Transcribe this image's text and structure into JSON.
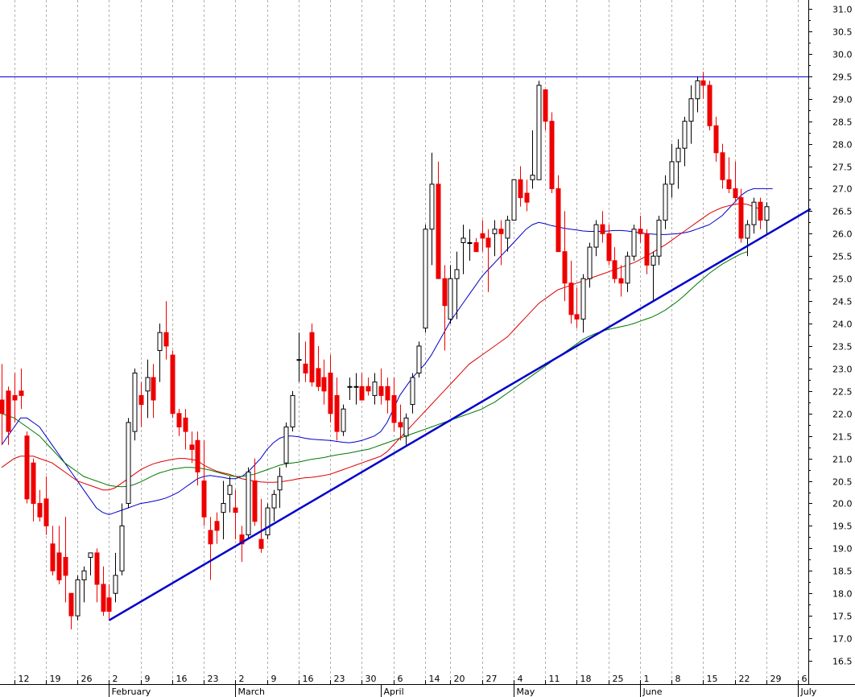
{
  "chart_data": {
    "type": "candlestick",
    "title": "",
    "xlabel": "",
    "ylabel": "",
    "ylim": [
      16.5,
      31.0
    ],
    "y_ticks": [
      "16.5",
      "17.0",
      "17.5",
      "18.0",
      "18.5",
      "19.0",
      "19.5",
      "20.0",
      "20.5",
      "21.0",
      "21.5",
      "22.0",
      "22.5",
      "23.0",
      "23.5",
      "24.0",
      "24.5",
      "25.0",
      "25.5",
      "26.0",
      "26.5",
      "27.0",
      "27.5",
      "28.0",
      "28.5",
      "29.0",
      "29.5",
      "30.0",
      "30.5",
      "31.0"
    ],
    "x_day_ticks": [
      {
        "label": "12",
        "i": 2
      },
      {
        "label": "19",
        "i": 7
      },
      {
        "label": "26",
        "i": 12
      },
      {
        "label": "2",
        "i": 17
      },
      {
        "label": "9",
        "i": 22
      },
      {
        "label": "16",
        "i": 27
      },
      {
        "label": "23",
        "i": 32
      },
      {
        "label": "2",
        "i": 37
      },
      {
        "label": "9",
        "i": 42
      },
      {
        "label": "16",
        "i": 47
      },
      {
        "label": "23",
        "i": 52
      },
      {
        "label": "30",
        "i": 57
      },
      {
        "label": "6",
        "i": 62
      },
      {
        "label": "14",
        "i": 67
      },
      {
        "label": "20",
        "i": 71
      },
      {
        "label": "27",
        "i": 76
      },
      {
        "label": "4",
        "i": 81
      },
      {
        "label": "11",
        "i": 86
      },
      {
        "label": "18",
        "i": 91
      },
      {
        "label": "25",
        "i": 96
      },
      {
        "label": "1",
        "i": 101
      },
      {
        "label": "8",
        "i": 106
      },
      {
        "label": "15",
        "i": 111
      },
      {
        "label": "22",
        "i": 116
      },
      {
        "label": "29",
        "i": 121
      },
      {
        "label": "6",
        "i": 126
      }
    ],
    "x_month_ticks": [
      {
        "label": "February",
        "i": 17
      },
      {
        "label": "March",
        "i": 37
      },
      {
        "label": "April",
        "i": 60
      },
      {
        "label": "May",
        "i": 81
      },
      {
        "label": "June",
        "i": 101
      },
      {
        "label": "July",
        "i": 126
      }
    ],
    "candles": [
      [
        22.3,
        23.1,
        21.3,
        22.0
      ],
      [
        22.5,
        22.6,
        21.3,
        21.6
      ],
      [
        22.4,
        22.9,
        21.8,
        22.3
      ],
      [
        22.5,
        23.0,
        22.1,
        22.4
      ],
      [
        21.5,
        21.6,
        20.0,
        20.1
      ],
      [
        20.9,
        21.0,
        19.6,
        20.0
      ],
      [
        20.0,
        20.3,
        19.6,
        19.7
      ],
      [
        20.1,
        20.6,
        19.3,
        19.5
      ],
      [
        19.1,
        19.5,
        18.4,
        18.5
      ],
      [
        18.9,
        19.5,
        18.2,
        18.3
      ],
      [
        18.8,
        19.7,
        17.8,
        18.4
      ],
      [
        18.0,
        18.0,
        17.2,
        17.5
      ],
      [
        17.5,
        18.4,
        17.4,
        18.3
      ],
      [
        18.3,
        18.6,
        17.8,
        18.5
      ],
      [
        18.8,
        18.9,
        18.4,
        18.9
      ],
      [
        18.9,
        19.0,
        17.8,
        18.2
      ],
      [
        18.2,
        18.6,
        17.5,
        17.6
      ],
      [
        17.9,
        18.2,
        17.4,
        17.6
      ],
      [
        18.0,
        18.9,
        17.8,
        18.4
      ],
      [
        18.5,
        20.0,
        18.4,
        19.5
      ],
      [
        20.0,
        21.9,
        19.9,
        21.8
      ],
      [
        21.6,
        23.0,
        21.4,
        22.9
      ],
      [
        22.4,
        22.7,
        21.7,
        22.2
      ],
      [
        22.5,
        23.2,
        21.9,
        22.8
      ],
      [
        22.8,
        23.1,
        21.9,
        22.3
      ],
      [
        23.4,
        24.0,
        22.7,
        23.8
      ],
      [
        23.8,
        24.5,
        23.2,
        23.5
      ],
      [
        23.3,
        23.4,
        21.9,
        22.0
      ],
      [
        22.0,
        22.1,
        21.5,
        21.7
      ],
      [
        21.9,
        22.1,
        21.2,
        21.6
      ],
      [
        21.3,
        21.6,
        20.9,
        21.2
      ],
      [
        21.4,
        21.6,
        20.4,
        20.7
      ],
      [
        20.5,
        21.4,
        19.5,
        19.7
      ],
      [
        19.4,
        19.7,
        18.3,
        19.1
      ],
      [
        19.6,
        19.8,
        19.1,
        19.4
      ],
      [
        19.8,
        20.5,
        19.2,
        20.0
      ],
      [
        20.2,
        20.6,
        19.8,
        20.4
      ],
      [
        19.9,
        20.3,
        19.2,
        19.8
      ],
      [
        19.3,
        19.5,
        18.7,
        19.1
      ],
      [
        19.3,
        20.8,
        19.2,
        20.7
      ],
      [
        20.5,
        21.0,
        19.5,
        19.6
      ],
      [
        19.2,
        20.1,
        18.9,
        19.0
      ],
      [
        19.3,
        20.0,
        19.2,
        19.9
      ],
      [
        19.9,
        20.3,
        19.6,
        20.2
      ],
      [
        20.3,
        20.8,
        19.9,
        20.6
      ],
      [
        20.9,
        21.8,
        20.8,
        21.7
      ],
      [
        21.7,
        22.5,
        21.6,
        22.4
      ],
      [
        23.2,
        23.8,
        22.7,
        23.2
      ],
      [
        23.1,
        23.6,
        22.7,
        22.9
      ],
      [
        23.8,
        24.0,
        22.6,
        22.7
      ],
      [
        23.0,
        23.5,
        22.5,
        22.6
      ],
      [
        22.8,
        23.2,
        22.2,
        22.5
      ],
      [
        22.9,
        23.3,
        21.8,
        22.0
      ],
      [
        22.4,
        22.8,
        21.4,
        21.6
      ],
      [
        21.6,
        22.2,
        21.5,
        22.1
      ],
      [
        22.6,
        22.8,
        22.3,
        22.6
      ],
      [
        22.6,
        22.9,
        22.2,
        22.6
      ],
      [
        22.6,
        22.9,
        22.3,
        22.3
      ],
      [
        22.6,
        22.8,
        22.4,
        22.5
      ],
      [
        22.4,
        22.9,
        22.2,
        22.7
      ],
      [
        22.6,
        23.0,
        22.2,
        22.4
      ],
      [
        22.6,
        22.8,
        22.0,
        22.3
      ],
      [
        22.4,
        22.8,
        21.6,
        21.8
      ],
      [
        21.8,
        22.2,
        21.4,
        21.7
      ],
      [
        21.5,
        22.0,
        21.3,
        21.9
      ],
      [
        22.2,
        22.9,
        22.0,
        22.8
      ],
      [
        22.9,
        23.6,
        22.8,
        23.5
      ],
      [
        23.9,
        26.2,
        23.8,
        26.1
      ],
      [
        26.1,
        27.8,
        25.3,
        27.1
      ],
      [
        27.1,
        27.6,
        25.0,
        25.0
      ],
      [
        25.0,
        25.3,
        23.4,
        24.4
      ],
      [
        24.1,
        25.3,
        24.0,
        25.0
      ],
      [
        25.0,
        25.6,
        24.1,
        25.2
      ],
      [
        25.8,
        26.2,
        25.1,
        25.9
      ],
      [
        25.8,
        26.1,
        25.4,
        25.8
      ],
      [
        25.8,
        25.9,
        25.6,
        25.6
      ],
      [
        26.0,
        26.3,
        25.6,
        25.9
      ],
      [
        25.9,
        26.1,
        24.7,
        25.7
      ],
      [
        26.0,
        26.3,
        25.5,
        26.1
      ],
      [
        26.1,
        26.3,
        25.3,
        26.0
      ],
      [
        25.9,
        26.4,
        25.6,
        26.3
      ],
      [
        26.3,
        27.2,
        26.3,
        27.2
      ],
      [
        27.2,
        27.5,
        26.6,
        26.8
      ],
      [
        26.9,
        27.2,
        26.5,
        26.7
      ],
      [
        27.2,
        28.3,
        27.0,
        27.3
      ],
      [
        27.2,
        29.4,
        27.2,
        29.3
      ],
      [
        29.2,
        29.2,
        28.3,
        28.5
      ],
      [
        28.5,
        28.7,
        26.9,
        27.0
      ],
      [
        27.0,
        27.3,
        25.6,
        25.6
      ],
      [
        25.6,
        26.5,
        24.5,
        24.9
      ],
      [
        24.9,
        25.4,
        24.0,
        24.2
      ],
      [
        24.2,
        24.8,
        23.9,
        24.1
      ],
      [
        24.1,
        25.1,
        23.8,
        25.0
      ],
      [
        25.0,
        25.8,
        24.8,
        25.7
      ],
      [
        25.7,
        26.3,
        25.5,
        26.2
      ],
      [
        26.2,
        26.5,
        25.8,
        26.0
      ],
      [
        26.0,
        26.2,
        25.3,
        25.4
      ],
      [
        25.4,
        25.7,
        24.9,
        25.0
      ],
      [
        25.0,
        25.3,
        24.6,
        24.9
      ],
      [
        24.9,
        25.6,
        24.7,
        25.5
      ],
      [
        25.5,
        26.2,
        25.4,
        26.1
      ],
      [
        26.1,
        26.4,
        25.8,
        26.0
      ],
      [
        26.0,
        26.1,
        25.1,
        25.3
      ],
      [
        25.3,
        25.6,
        24.5,
        25.5
      ],
      [
        25.5,
        26.4,
        25.3,
        26.3
      ],
      [
        26.3,
        27.3,
        26.1,
        27.1
      ],
      [
        27.1,
        28.0,
        26.8,
        27.6
      ],
      [
        27.6,
        28.1,
        27.0,
        27.9
      ],
      [
        27.9,
        28.6,
        27.5,
        28.5
      ],
      [
        28.5,
        29.3,
        28.0,
        29.0
      ],
      [
        29.0,
        29.5,
        28.7,
        29.4
      ],
      [
        29.4,
        29.6,
        29.0,
        29.3
      ],
      [
        29.3,
        29.4,
        28.3,
        28.4
      ],
      [
        28.4,
        28.6,
        27.6,
        27.8
      ],
      [
        27.8,
        28.0,
        27.0,
        27.2
      ],
      [
        27.2,
        27.7,
        26.9,
        27.0
      ],
      [
        27.0,
        27.6,
        26.7,
        26.8
      ],
      [
        26.8,
        27.0,
        25.8,
        25.9
      ],
      [
        25.9,
        26.3,
        25.5,
        26.2
      ],
      [
        26.2,
        26.8,
        26.0,
        26.7
      ],
      [
        26.7,
        26.8,
        26.1,
        26.3
      ],
      [
        26.3,
        26.7,
        26.0,
        26.6
      ]
    ],
    "series": [
      {
        "color": "#0000cc",
        "values": [
          21.3,
          21.5,
          21.7,
          21.9,
          21.9,
          21.8,
          21.7,
          21.5,
          21.3,
          21.1,
          20.9,
          20.7,
          20.5,
          20.3,
          20.1,
          19.9,
          19.8,
          19.75,
          19.8,
          19.85,
          19.9,
          19.95,
          20.0,
          20.02,
          20.05,
          20.08,
          20.12,
          20.18,
          20.25,
          20.35,
          20.45,
          20.55,
          20.6,
          20.62,
          20.6,
          20.58,
          20.55,
          20.55,
          20.6,
          20.7,
          20.85,
          21.0,
          21.2,
          21.35,
          21.45,
          21.5,
          21.5,
          21.48,
          21.45,
          21.43,
          21.42,
          21.41,
          21.4,
          21.38,
          21.36,
          21.35,
          21.37,
          21.4,
          21.45,
          21.5,
          21.6,
          21.8,
          22.1,
          22.4,
          22.6,
          22.8,
          22.95,
          23.1,
          23.3,
          23.55,
          23.8,
          24.05,
          24.25,
          24.45,
          24.65,
          24.85,
          25.05,
          25.2,
          25.35,
          25.5,
          25.65,
          25.8,
          25.95,
          26.1,
          26.2,
          26.25,
          26.22,
          26.18,
          26.15,
          26.12,
          26.1,
          26.08,
          26.06,
          26.05,
          26.05,
          26.05,
          26.06,
          26.07,
          26.07,
          26.06,
          26.04,
          26.02,
          26.0,
          25.99,
          25.98,
          25.98,
          25.99,
          26.0,
          26.02,
          26.05,
          26.1,
          26.15,
          26.2,
          26.3,
          26.4,
          26.55,
          26.7,
          26.85,
          26.95,
          27.0,
          27.0,
          27.0,
          27.0
        ]
      },
      {
        "color": "#dd0000",
        "values": [
          20.8,
          20.9,
          21.0,
          21.05,
          21.05,
          21.05,
          21.0,
          20.95,
          20.9,
          20.8,
          20.7,
          20.6,
          20.5,
          20.45,
          20.4,
          20.35,
          20.3,
          20.3,
          20.35,
          20.45,
          20.55,
          20.65,
          20.75,
          20.82,
          20.88,
          20.92,
          20.95,
          20.98,
          21.0,
          21.0,
          20.98,
          20.95,
          20.85,
          20.78,
          20.72,
          20.68,
          20.65,
          20.6,
          20.55,
          20.52,
          20.5,
          20.48,
          20.47,
          20.47,
          20.48,
          20.5,
          20.52,
          20.55,
          20.57,
          20.58,
          20.6,
          20.62,
          20.65,
          20.7,
          20.75,
          20.8,
          20.85,
          20.9,
          20.95,
          21.0,
          21.05,
          21.15,
          21.3,
          21.45,
          21.6,
          21.75,
          21.9,
          22.05,
          22.2,
          22.35,
          22.5,
          22.65,
          22.8,
          22.95,
          23.1,
          23.2,
          23.3,
          23.4,
          23.5,
          23.6,
          23.7,
          23.85,
          24.0,
          24.15,
          24.3,
          24.45,
          24.55,
          24.65,
          24.75,
          24.8,
          24.85,
          24.9,
          24.95,
          25.0,
          25.05,
          25.1,
          25.15,
          25.2,
          25.25,
          25.3,
          25.35,
          25.42,
          25.5,
          25.58,
          25.67,
          25.75,
          25.85,
          25.95,
          26.05,
          26.15,
          26.25,
          26.35,
          26.45,
          26.52,
          26.58,
          26.62,
          26.65,
          26.67,
          26.65,
          26.6,
          26.55
        ]
      },
      {
        "color": "#007700",
        "values": [
          22.0,
          21.95,
          21.9,
          21.8,
          21.7,
          21.6,
          21.5,
          21.35,
          21.2,
          21.05,
          20.9,
          20.8,
          20.7,
          20.6,
          20.55,
          20.5,
          20.45,
          20.4,
          20.38,
          20.37,
          20.38,
          20.42,
          20.48,
          20.55,
          20.62,
          20.68,
          20.72,
          20.76,
          20.78,
          20.8,
          20.8,
          20.79,
          20.77,
          20.74,
          20.7,
          20.66,
          20.62,
          20.6,
          20.6,
          20.62,
          20.65,
          20.7,
          20.75,
          20.8,
          20.85,
          20.88,
          20.9,
          20.92,
          20.95,
          20.98,
          21.0,
          21.02,
          21.05,
          21.08,
          21.1,
          21.12,
          21.15,
          21.18,
          21.2,
          21.25,
          21.3,
          21.35,
          21.4,
          21.45,
          21.5,
          21.55,
          21.6,
          21.65,
          21.7,
          21.75,
          21.8,
          21.85,
          21.9,
          21.95,
          22.0,
          22.05,
          22.1,
          22.18,
          22.25,
          22.35,
          22.45,
          22.55,
          22.65,
          22.75,
          22.85,
          22.95,
          23.05,
          23.15,
          23.25,
          23.35,
          23.45,
          23.55,
          23.65,
          23.72,
          23.78,
          23.83,
          23.87,
          23.9,
          23.93,
          23.96,
          24.0,
          24.05,
          24.1,
          24.15,
          24.22,
          24.3,
          24.4,
          24.5,
          24.62,
          24.75,
          24.88,
          25.0,
          25.12,
          25.22,
          25.32,
          25.4,
          25.48,
          25.55,
          25.6
        ]
      }
    ],
    "trend_line": {
      "from": [
        17,
        17.4
      ],
      "to": [
        128,
        26.55
      ]
    },
    "resistance_level": 29.5
  }
}
